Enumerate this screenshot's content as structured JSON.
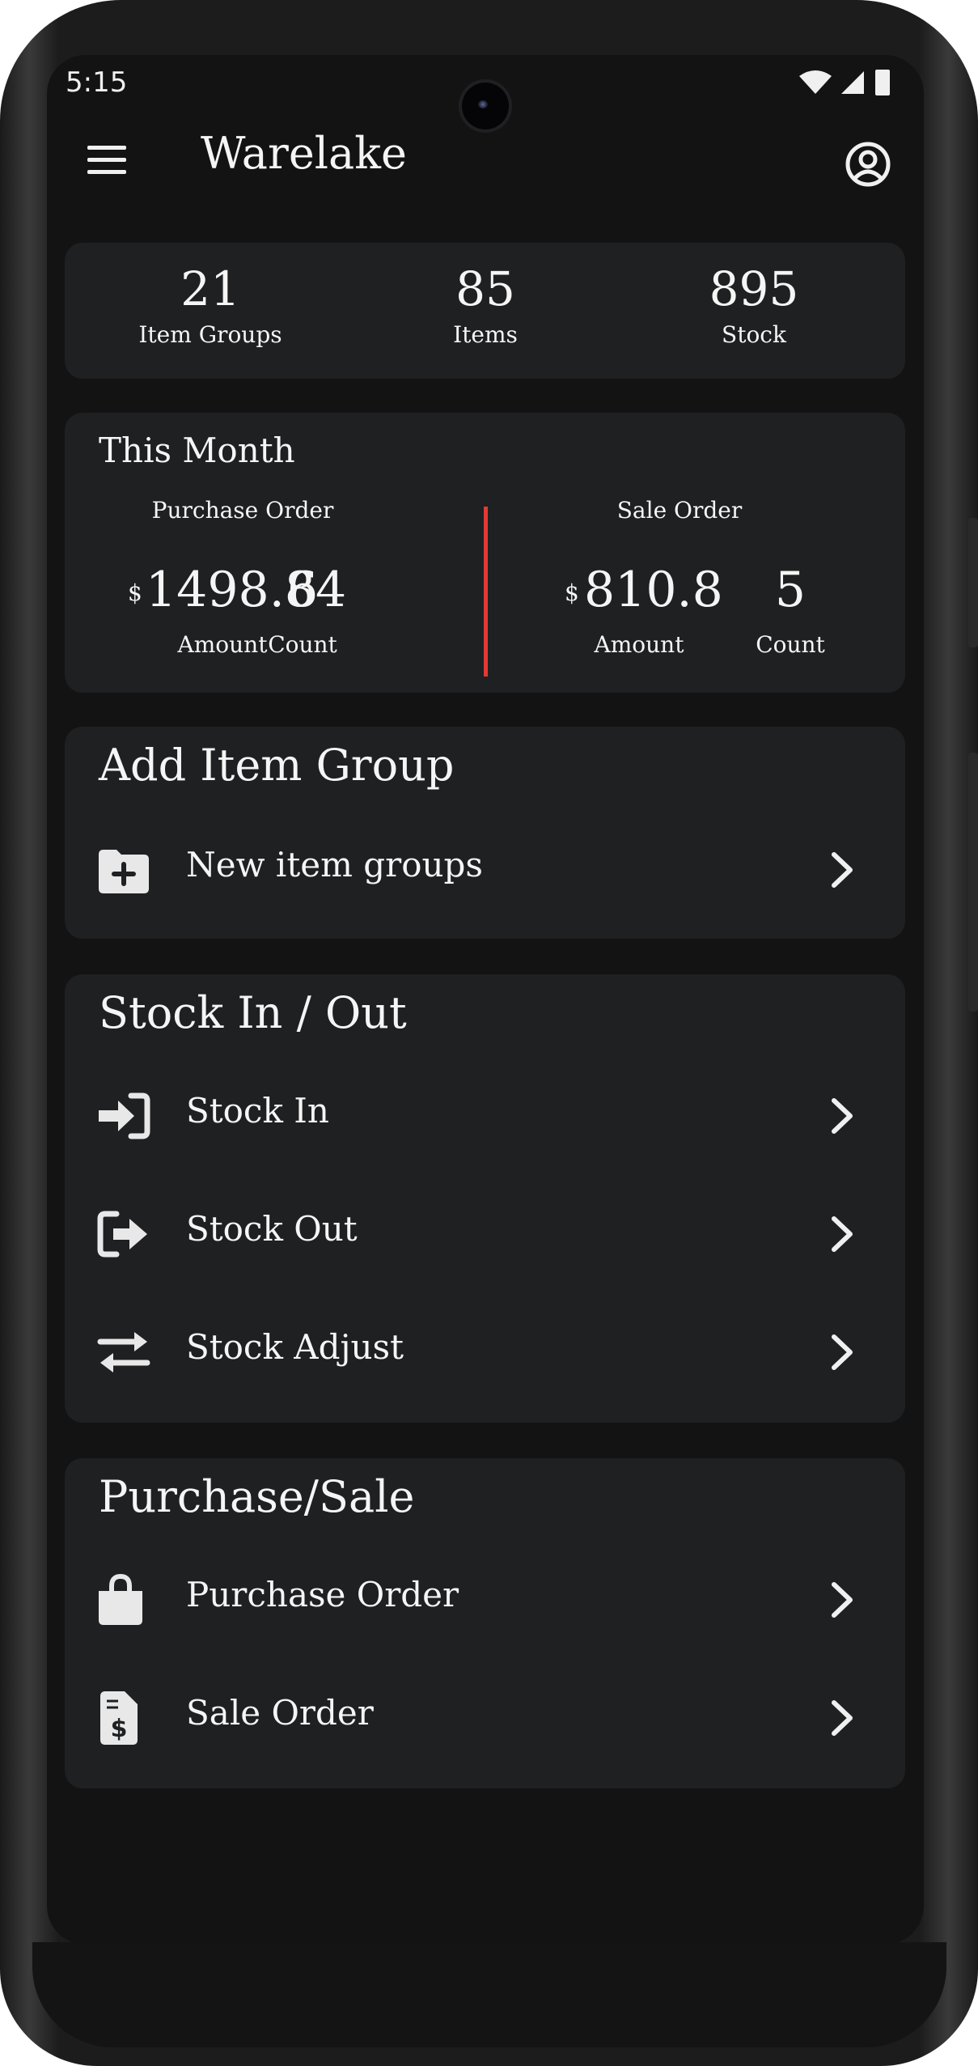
{
  "status_bar": {
    "time": "5:15"
  },
  "app_bar": {
    "title": "Warelake"
  },
  "summary": [
    {
      "value": "21",
      "label": "Item Groups"
    },
    {
      "value": "85",
      "label": "Items"
    },
    {
      "value": "895",
      "label": "Stock"
    }
  ],
  "this_month": {
    "title": "This Month",
    "purchase": {
      "heading": "Purchase Order",
      "currency": "$",
      "amount": "1498.84",
      "amount_label": "Amount",
      "count": "6",
      "count_label": "Count"
    },
    "sale": {
      "heading": "Sale Order",
      "currency": "$",
      "amount": "810.8",
      "amount_label": "Amount",
      "count": "5",
      "count_label": "Count"
    },
    "divider_color": "#e53935"
  },
  "add_item_group": {
    "title": "Add Item Group",
    "items": [
      {
        "label": "New item groups",
        "icon": "folder-plus-icon"
      }
    ]
  },
  "stock": {
    "title": "Stock In / Out",
    "items": [
      {
        "label": "Stock In",
        "icon": "sign-in-icon"
      },
      {
        "label": "Stock Out",
        "icon": "sign-out-icon"
      },
      {
        "label": "Stock Adjust",
        "icon": "arrows-exchange-icon"
      }
    ]
  },
  "purchase_sale": {
    "title": "Purchase/Sale",
    "items": [
      {
        "label": "Purchase Order",
        "icon": "shopping-bag-icon"
      },
      {
        "label": "Sale Order",
        "icon": "invoice-dollar-icon"
      }
    ]
  },
  "colors": {
    "background": "#131314",
    "card": "#1f2022",
    "text": "#f5f5f5",
    "accent": "#e53935"
  }
}
